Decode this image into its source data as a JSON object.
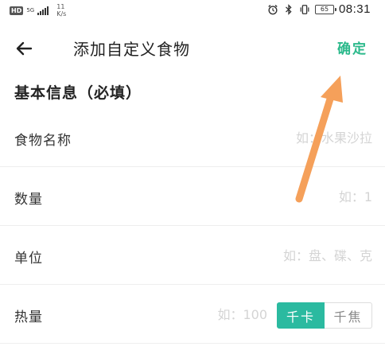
{
  "status_bar": {
    "hd_badge": "HD",
    "network_type": "5G",
    "net_speed_value": "11",
    "net_speed_unit": "K/s",
    "battery_level": "65",
    "time": "08:31"
  },
  "header": {
    "title": "添加自定义食物",
    "confirm_label": "确定"
  },
  "section": {
    "title": "基本信息（必填）"
  },
  "form": {
    "food_name": {
      "label": "食物名称",
      "placeholder": "如：水果沙拉",
      "value": ""
    },
    "quantity": {
      "label": "数量",
      "placeholder": "如：1",
      "value": ""
    },
    "unit": {
      "label": "单位",
      "placeholder": "如：盘、碟、克",
      "value": ""
    },
    "calories": {
      "label": "热量",
      "placeholder": "如：100",
      "value": "",
      "units": [
        {
          "label": "千卡",
          "selected": true
        },
        {
          "label": "千焦",
          "selected": false
        }
      ]
    }
  },
  "colors": {
    "accent": "#2bb98b",
    "toggle_active": "#2bbaa0",
    "annotation_arrow": "#f5a05a"
  },
  "icons": {
    "back": "arrow-left-icon",
    "alarm": "alarm-icon",
    "bluetooth": "bluetooth-icon",
    "vibrate": "vibrate-icon"
  }
}
